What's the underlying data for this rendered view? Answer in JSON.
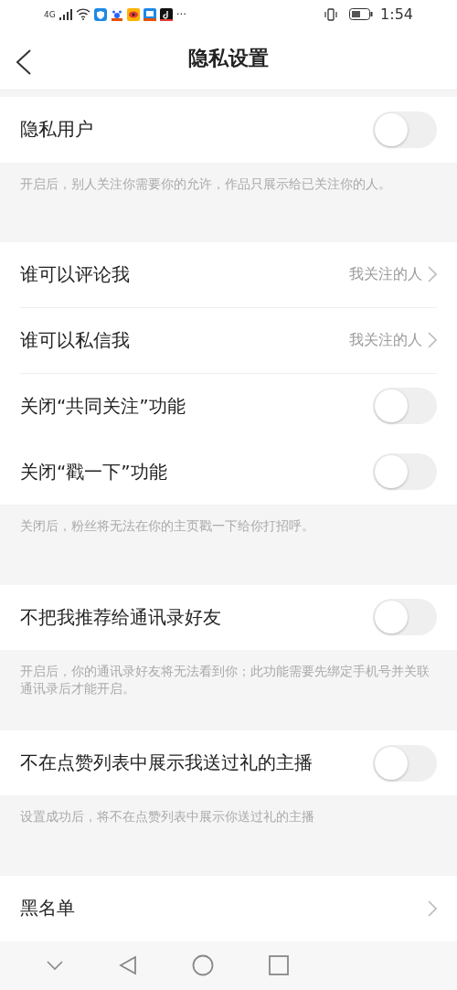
{
  "status_bar": {
    "network": "4G",
    "more": "···",
    "time": "1:54"
  },
  "header": {
    "title": "隐私设置"
  },
  "sections": [
    {
      "rows": [
        {
          "kind": "toggle",
          "label": "隐私用户",
          "on": false
        }
      ],
      "note": "开启后，别人关注你需要你的允许，作品只展示给已关注你的人。"
    },
    {
      "rows": [
        {
          "kind": "link",
          "label": "谁可以评论我",
          "value": "我关注的人"
        },
        {
          "kind": "link",
          "label": "谁可以私信我",
          "value": "我关注的人"
        },
        {
          "kind": "toggle",
          "label": "关闭“共同关注”功能",
          "on": false
        },
        {
          "kind": "toggle",
          "label": "关闭“戳一下”功能",
          "on": false
        }
      ],
      "note": "关闭后，粉丝将无法在你的主页戳一下给你打招呼。"
    },
    {
      "rows": [
        {
          "kind": "toggle",
          "label": "不把我推荐给通讯录好友",
          "on": false
        }
      ],
      "note": "开启后，你的通讯录好友将无法看到你；此功能需要先绑定手机号并关联通讯录后才能开启。"
    },
    {
      "rows": [
        {
          "kind": "toggle",
          "label": "不在点赞列表中展示我送过礼的主播",
          "on": false
        }
      ],
      "note": "设置成功后，将不在点赞列表中展示你送过礼的主播"
    },
    {
      "rows": [
        {
          "kind": "link",
          "label": "黑名单"
        }
      ]
    }
  ]
}
